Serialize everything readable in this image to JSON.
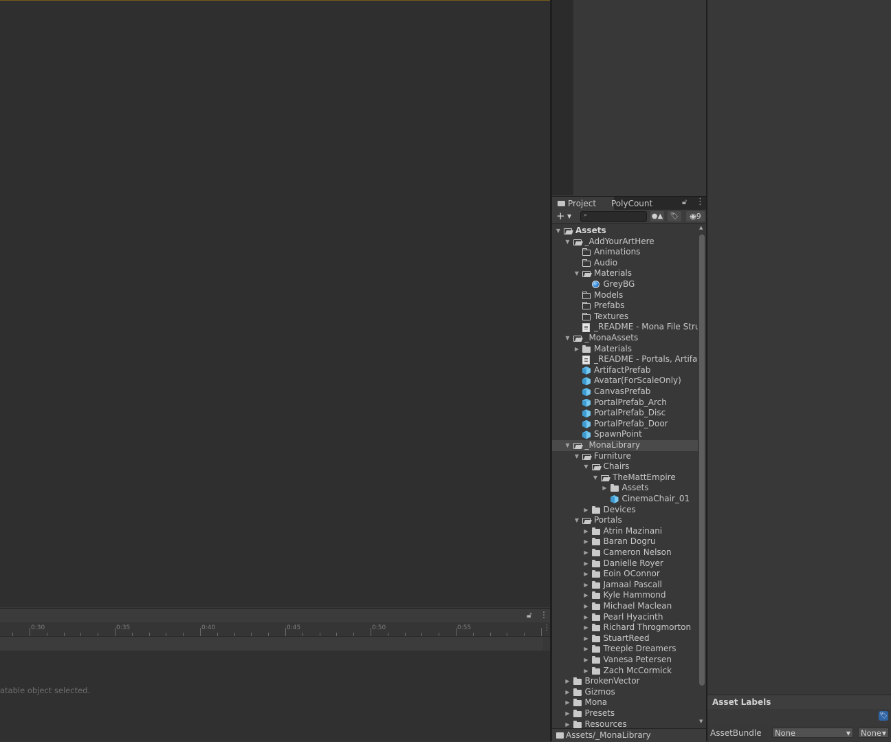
{
  "window": {
    "accent_color": "#7a5a1c"
  },
  "animation": {
    "ruler_labels": [
      "0:30",
      "0:35",
      "0:40",
      "0:45",
      "0:50",
      "0:55"
    ],
    "message": "atable object selected.",
    "lock_icon": "lock-icon",
    "menu_icon": "kebab-menu-icon"
  },
  "project": {
    "tabs": [
      {
        "label": "Project",
        "active": true
      },
      {
        "label": "PolyCount",
        "active": false
      }
    ],
    "toolbar": {
      "create_label": "+",
      "search_placeholder": "",
      "search_value": "",
      "hidden_count": "9"
    },
    "tree": [
      {
        "label": "Assets",
        "depth": 0,
        "expand": "open",
        "icon": "folder-open",
        "bold": true
      },
      {
        "label": "_AddYourArtHere",
        "depth": 1,
        "expand": "open",
        "icon": "folder-open"
      },
      {
        "label": "Animations",
        "depth": 2,
        "expand": "none",
        "icon": "folder-empty"
      },
      {
        "label": "Audio",
        "depth": 2,
        "expand": "none",
        "icon": "folder-empty"
      },
      {
        "label": "Materials",
        "depth": 2,
        "expand": "open",
        "icon": "folder-open"
      },
      {
        "label": "GreyBG",
        "depth": 3,
        "expand": "none",
        "icon": "material"
      },
      {
        "label": "Models",
        "depth": 2,
        "expand": "none",
        "icon": "folder-empty"
      },
      {
        "label": "Prefabs",
        "depth": 2,
        "expand": "none",
        "icon": "folder-empty"
      },
      {
        "label": "Textures",
        "depth": 2,
        "expand": "none",
        "icon": "folder-empty"
      },
      {
        "label": "_README - Mona File Struc",
        "depth": 2,
        "expand": "none",
        "icon": "document"
      },
      {
        "label": "_MonaAssets",
        "depth": 1,
        "expand": "open",
        "icon": "folder-open"
      },
      {
        "label": "Materials",
        "depth": 2,
        "expand": "closed",
        "icon": "folder"
      },
      {
        "label": "_README - Portals, Artifact",
        "depth": 2,
        "expand": "none",
        "icon": "document"
      },
      {
        "label": "ArtifactPrefab",
        "depth": 2,
        "expand": "none",
        "icon": "prefab"
      },
      {
        "label": "Avatar(ForScaleOnly)",
        "depth": 2,
        "expand": "none",
        "icon": "prefab"
      },
      {
        "label": "CanvasPrefab",
        "depth": 2,
        "expand": "none",
        "icon": "prefab"
      },
      {
        "label": "PortalPrefab_Arch",
        "depth": 2,
        "expand": "none",
        "icon": "prefab"
      },
      {
        "label": "PortalPrefab_Disc",
        "depth": 2,
        "expand": "none",
        "icon": "prefab"
      },
      {
        "label": "PortalPrefab_Door",
        "depth": 2,
        "expand": "none",
        "icon": "prefab"
      },
      {
        "label": "SpawnPoint",
        "depth": 2,
        "expand": "none",
        "icon": "prefab"
      },
      {
        "label": "_MonaLibrary",
        "depth": 1,
        "expand": "open",
        "icon": "folder-open",
        "selected": true
      },
      {
        "label": "Furniture",
        "depth": 2,
        "expand": "open",
        "icon": "folder-open"
      },
      {
        "label": "Chairs",
        "depth": 3,
        "expand": "open",
        "icon": "folder-open"
      },
      {
        "label": "TheMattEmpire",
        "depth": 4,
        "expand": "open",
        "icon": "folder-open"
      },
      {
        "label": "Assets",
        "depth": 5,
        "expand": "closed",
        "icon": "folder"
      },
      {
        "label": "CinemaChair_01",
        "depth": 5,
        "expand": "none",
        "icon": "prefab"
      },
      {
        "label": "Devices",
        "depth": 3,
        "expand": "closed",
        "icon": "folder"
      },
      {
        "label": "Portals",
        "depth": 2,
        "expand": "open",
        "icon": "folder-open"
      },
      {
        "label": "Atrin Mazinani",
        "depth": 3,
        "expand": "closed",
        "icon": "folder"
      },
      {
        "label": "Baran Dogru",
        "depth": 3,
        "expand": "closed",
        "icon": "folder"
      },
      {
        "label": "Cameron Nelson",
        "depth": 3,
        "expand": "closed",
        "icon": "folder"
      },
      {
        "label": "Danielle Royer",
        "depth": 3,
        "expand": "closed",
        "icon": "folder"
      },
      {
        "label": "Eoin OConnor",
        "depth": 3,
        "expand": "closed",
        "icon": "folder"
      },
      {
        "label": "Jamaal Pascall",
        "depth": 3,
        "expand": "closed",
        "icon": "folder"
      },
      {
        "label": "Kyle Hammond",
        "depth": 3,
        "expand": "closed",
        "icon": "folder"
      },
      {
        "label": "Michael Maclean",
        "depth": 3,
        "expand": "closed",
        "icon": "folder"
      },
      {
        "label": "Pearl Hyacinth",
        "depth": 3,
        "expand": "closed",
        "icon": "folder"
      },
      {
        "label": "Richard Throgmorton",
        "depth": 3,
        "expand": "closed",
        "icon": "folder"
      },
      {
        "label": "StuartReed",
        "depth": 3,
        "expand": "closed",
        "icon": "folder"
      },
      {
        "label": "Treeple Dreamers",
        "depth": 3,
        "expand": "closed",
        "icon": "folder"
      },
      {
        "label": "Vanesa Petersen",
        "depth": 3,
        "expand": "closed",
        "icon": "folder"
      },
      {
        "label": "Zach McCormick",
        "depth": 3,
        "expand": "closed",
        "icon": "folder"
      },
      {
        "label": "BrokenVector",
        "depth": 1,
        "expand": "closed",
        "icon": "folder"
      },
      {
        "label": "Gizmos",
        "depth": 1,
        "expand": "closed",
        "icon": "folder"
      },
      {
        "label": "Mona",
        "depth": 1,
        "expand": "closed",
        "icon": "folder"
      },
      {
        "label": "Presets",
        "depth": 1,
        "expand": "closed",
        "icon": "folder"
      },
      {
        "label": "Resources",
        "depth": 1,
        "expand": "closed",
        "icon": "folder"
      }
    ],
    "path": "Assets/_MonaLibrary"
  },
  "inspector": {
    "asset_labels_title": "Asset Labels",
    "asset_bundle_label": "AssetBundle",
    "bundle_name": "None",
    "bundle_variant": "None",
    "tag_color": "#2f64a6"
  }
}
